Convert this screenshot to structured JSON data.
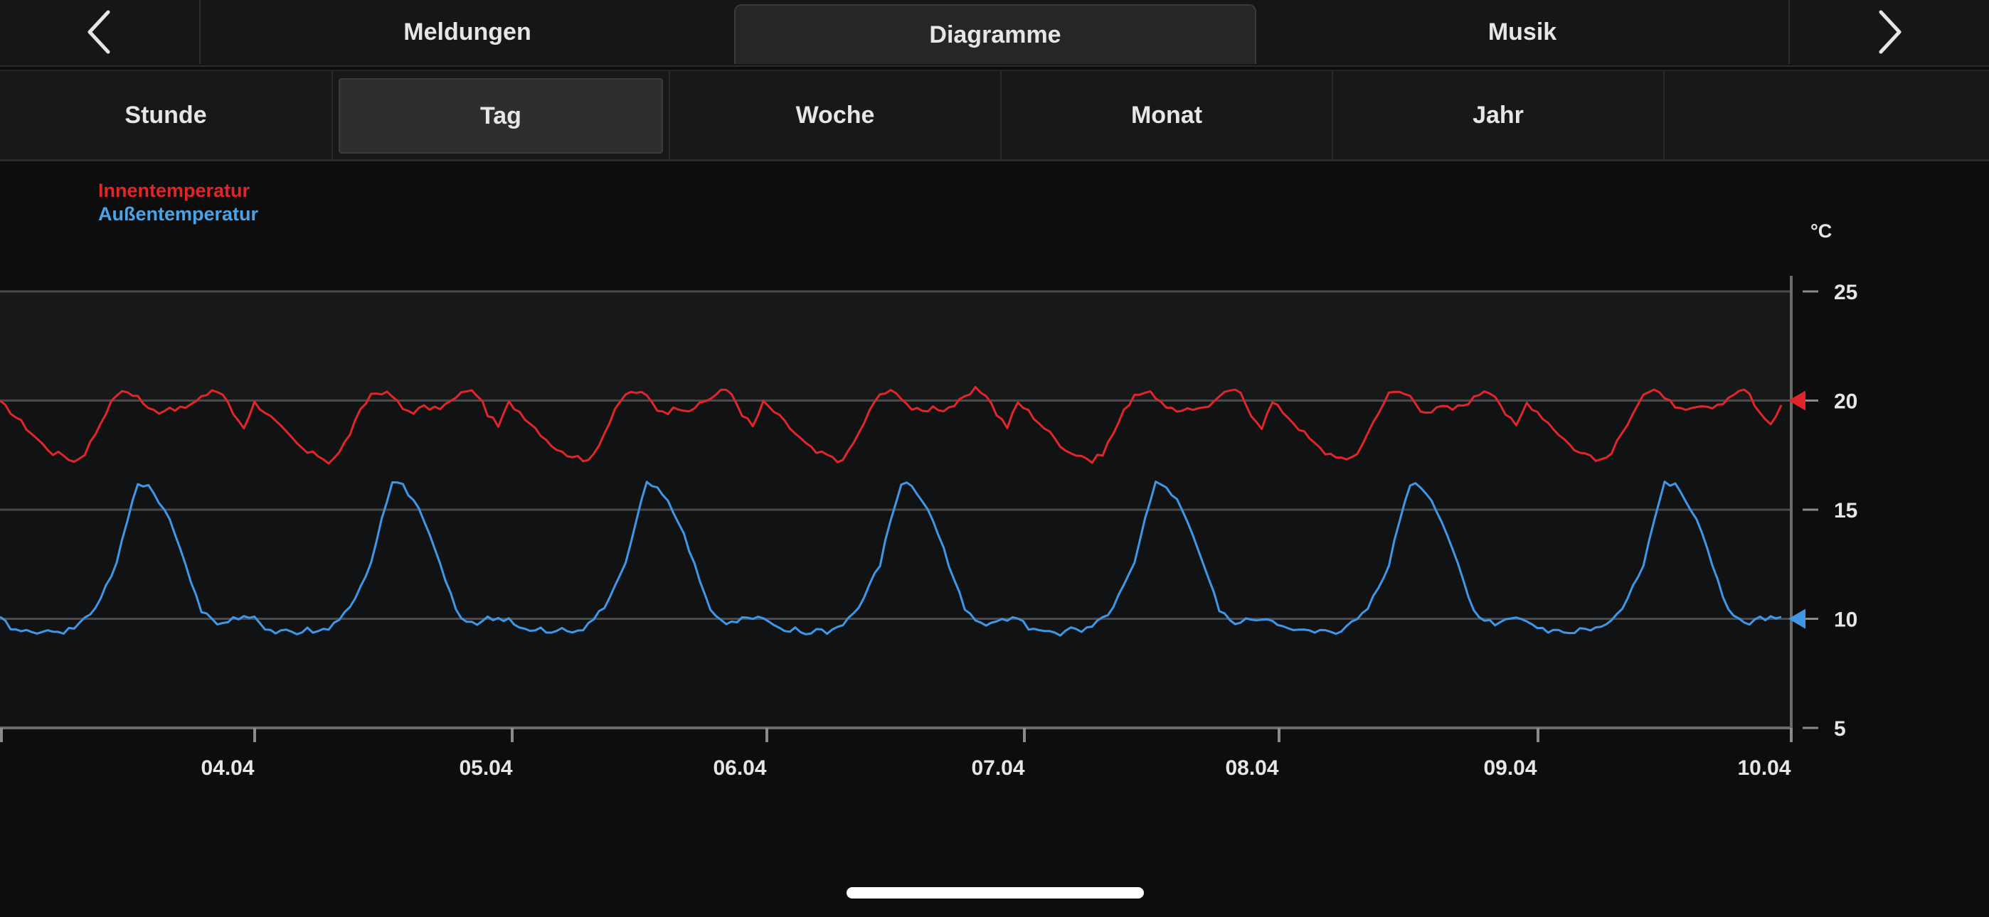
{
  "nav": {
    "prev_icon": "chevron-left-icon",
    "next_icon": "chevron-right-icon",
    "tabs": [
      {
        "label": "Meldungen",
        "active": false
      },
      {
        "label": "Diagramme",
        "active": true
      },
      {
        "label": "Musik",
        "active": false
      }
    ]
  },
  "periods": [
    {
      "label": "Stunde",
      "active": false
    },
    {
      "label": "Tag",
      "active": true
    },
    {
      "label": "Woche",
      "active": false
    },
    {
      "label": "Monat",
      "active": false
    },
    {
      "label": "Jahr",
      "active": false
    }
  ],
  "legend": {
    "indoor": "Innentemperatur",
    "outdoor": "Außentemperatur"
  },
  "colors": {
    "indoor": "#e0262a",
    "outdoor": "#3f97e8",
    "background": "#0d0d0d"
  },
  "chart_data": {
    "type": "line",
    "unit": "°C",
    "ylim": [
      5,
      25
    ],
    "yticks": [
      5,
      10,
      15,
      20,
      25
    ],
    "xtick_labels": [
      "04.04",
      "05.04",
      "06.04",
      "07.04",
      "08.04",
      "09.04",
      "10.04"
    ],
    "grid": true,
    "legend_position": "top-left",
    "x_start": "03.04",
    "x_end": "10.04",
    "series": [
      {
        "name": "Innentemperatur",
        "color": "#e0262a",
        "current": 20,
        "daily_hourly": [
          19.9,
          19.5,
          19.0,
          18.5,
          18.0,
          17.6,
          17.5,
          17.2,
          17.6,
          18.5,
          19.5,
          20.3,
          20.4,
          20.2,
          19.6,
          19.5,
          19.7,
          19.6,
          19.8,
          20.1,
          20.5,
          20.3,
          19.4,
          18.8
        ]
      },
      {
        "name": "Außentemperatur",
        "color": "#3f97e8",
        "current": 10,
        "daily_hourly": [
          10.0,
          9.6,
          9.4,
          9.5,
          9.3,
          9.5,
          9.4,
          9.6,
          10.0,
          10.5,
          11.5,
          12.5,
          14.5,
          16.2,
          16.1,
          15.4,
          14.5,
          13.2,
          11.8,
          10.4,
          9.9,
          9.8,
          10.0,
          10.0
        ]
      }
    ]
  }
}
